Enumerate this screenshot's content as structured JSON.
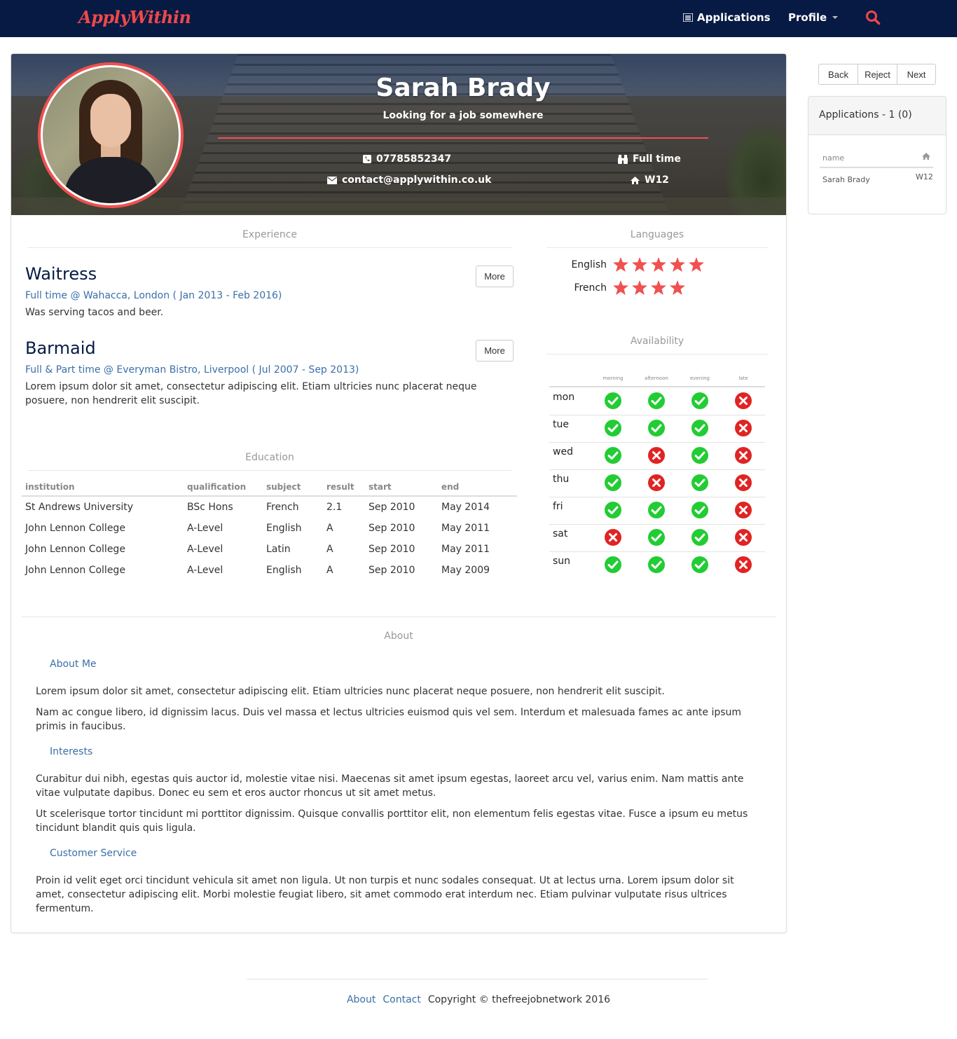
{
  "nav": {
    "brand": "ApplyWithin",
    "applications_label": "Applications",
    "profile_label": "Profile"
  },
  "profile": {
    "name": "Sarah Brady",
    "tagline": "Looking for a job somewhere",
    "phone": "07785852347",
    "email": "contact@applywithin.co.uk",
    "job_type": "Full time",
    "location": "W12"
  },
  "experience": {
    "heading": "Experience",
    "jobs": [
      {
        "title": "Waitress",
        "meta": "Full time @ Wahacca, London ( Jan 2013 - Feb 2016)",
        "description": "Was serving tacos and beer.",
        "more_label": "More"
      },
      {
        "title": "Barmaid",
        "meta": "Full & Part time @ Everyman Bistro, Liverpool ( Jul 2007 - Sep 2013)",
        "description": "Lorem ipsum dolor sit amet, consectetur adipiscing elit. Etiam ultricies nunc placerat neque posuere, non hendrerit elit suscipit.",
        "more_label": "More"
      }
    ]
  },
  "education": {
    "heading": "Education",
    "columns": [
      "institution",
      "qualification",
      "subject",
      "result",
      "start",
      "end"
    ],
    "rows": [
      [
        "St Andrews University",
        "BSc Hons",
        "French",
        "2.1",
        "Sep 2010",
        "May 2014"
      ],
      [
        "John Lennon College",
        "A-Level",
        "English",
        "A",
        "Sep 2010",
        "May 2011"
      ],
      [
        "John Lennon College",
        "A-Level",
        "Latin",
        "A",
        "Sep 2010",
        "May 2011"
      ],
      [
        "John Lennon College",
        "A-Level",
        "English",
        "A",
        "Sep 2010",
        "May 2009"
      ]
    ]
  },
  "languages": {
    "heading": "Languages",
    "items": [
      {
        "name": "English",
        "stars": 5
      },
      {
        "name": "French",
        "stars": 4
      }
    ]
  },
  "availability": {
    "heading": "Availability",
    "columns": [
      "morning",
      "afternoon",
      "evening",
      "late"
    ],
    "rows": [
      {
        "day": "mon",
        "slots": [
          true,
          true,
          true,
          false
        ]
      },
      {
        "day": "tue",
        "slots": [
          true,
          true,
          true,
          false
        ]
      },
      {
        "day": "wed",
        "slots": [
          true,
          false,
          true,
          false
        ]
      },
      {
        "day": "thu",
        "slots": [
          true,
          false,
          true,
          false
        ]
      },
      {
        "day": "fri",
        "slots": [
          true,
          true,
          true,
          false
        ]
      },
      {
        "day": "sat",
        "slots": [
          false,
          true,
          true,
          false
        ]
      },
      {
        "day": "sun",
        "slots": [
          true,
          true,
          true,
          false
        ]
      }
    ]
  },
  "about": {
    "heading": "About",
    "sections": [
      {
        "title": "About Me",
        "paragraphs": [
          "Lorem ipsum dolor sit amet, consectetur adipiscing elit. Etiam ultricies nunc placerat neque posuere, non hendrerit elit suscipit.",
          "Nam ac congue libero, id dignissim lacus. Duis vel massa et lectus ultricies euismod quis vel sem. Interdum et malesuada fames ac ante ipsum primis in faucibus."
        ]
      },
      {
        "title": "Interests",
        "paragraphs": [
          "Curabitur dui nibh, egestas quis auctor id, molestie vitae nisi. Maecenas sit amet ipsum egestas, laoreet arcu vel, varius enim. Nam mattis ante vitae vulputate dapibus. Donec eu sem et eros auctor rhoncus ut sit amet metus.",
          "Ut scelerisque tortor tincidunt mi porttitor dignissim. Quisque convallis porttitor elit, non elementum felis egestas vitae. Fusce a ipsum eu metus tincidunt blandit quis quis ligula."
        ]
      },
      {
        "title": "Customer Service",
        "paragraphs": [
          "Proin id velit eget orci tincidunt vehicula sit amet non ligula. Ut non turpis et nunc sodales consequat. Ut at lectus urna. Lorem ipsum dolor sit amet, consectetur adipiscing elit. Morbi molestie feugiat libero, sit amet commodo erat interdum nec. Etiam pulvinar vulputate risus ultrices fermentum."
        ]
      }
    ]
  },
  "sidebar": {
    "buttons": [
      "Back",
      "Reject",
      "Next"
    ],
    "applications_title": "Applications - 1 (0)",
    "table_header": "name",
    "rows": [
      {
        "name": "Sarah Brady",
        "location": "W12"
      }
    ]
  },
  "footer": {
    "links": [
      "About",
      "Contact"
    ],
    "copyright": "Copyright © thefreejobnetwork 2016"
  },
  "colors": {
    "navbar": "#061a44",
    "accent": "#f05050",
    "link": "#3a6fa8",
    "available": "#22cc33",
    "unavailable": "#e02424"
  }
}
